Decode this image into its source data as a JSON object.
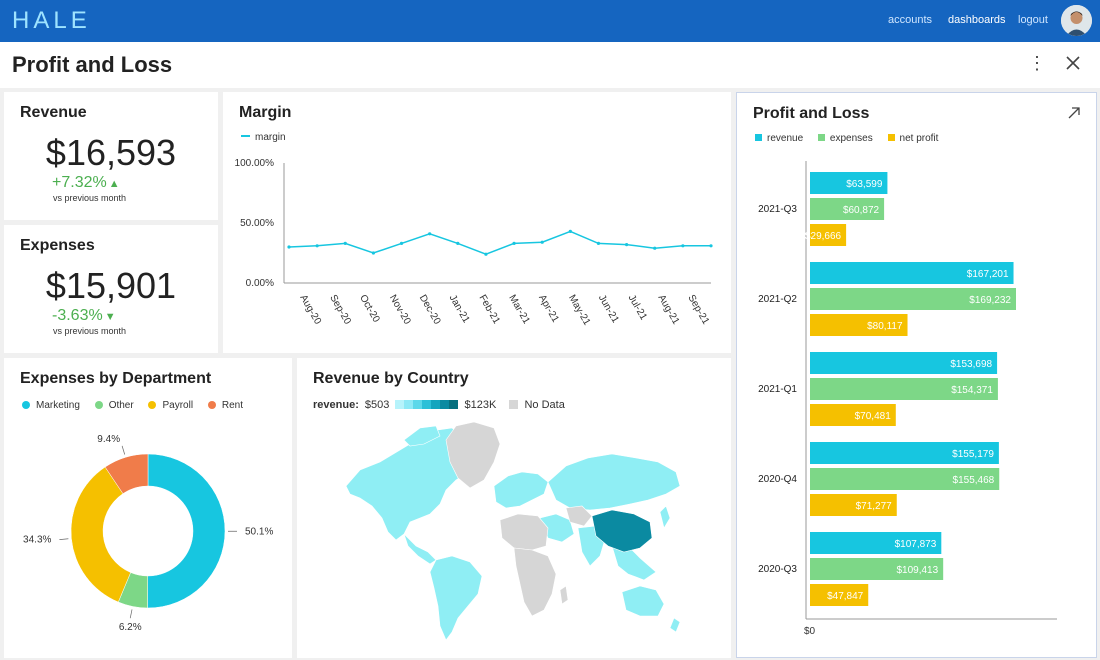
{
  "app": {
    "logo": "HALE",
    "nav": [
      {
        "label": "accounts"
      },
      {
        "label": "dashboards"
      },
      {
        "label": "logout"
      }
    ]
  },
  "page": {
    "title": "Profit and Loss"
  },
  "revenue_card": {
    "title": "Revenue",
    "value": "$16,593",
    "change": "+7.32%",
    "subtitle": "vs previous month"
  },
  "expenses_card": {
    "title": "Expenses",
    "value": "$15,901",
    "change": "-3.63%",
    "subtitle": "vs previous month"
  },
  "colors": {
    "up": "#4caf50",
    "down": "#4caf50",
    "revenue": "#17c6e0",
    "expenses": "#7dd787",
    "net_profit": "#f5c000",
    "rent": "#f07c4a",
    "no_data": "#d6d6d6"
  },
  "margin_card": {
    "title": "Margin",
    "legend": "margin"
  },
  "pl_card": {
    "title": "Profit and Loss",
    "legend": [
      "revenue",
      "expenses",
      "net profit"
    ],
    "axis_zero": "$0"
  },
  "dept_card": {
    "title": "Expenses by Department",
    "legend": [
      "Marketing",
      "Other",
      "Payroll",
      "Rent"
    ]
  },
  "country_card": {
    "title": "Revenue by Country",
    "scale_label": "revenue:",
    "scale_min": "$503",
    "scale_max": "$123K",
    "no_data": "No Data"
  },
  "chart_data": [
    {
      "type": "line",
      "title": "Margin",
      "series": [
        {
          "name": "margin",
          "values": [
            30,
            31,
            33,
            25,
            33,
            41,
            33,
            24,
            33,
            34,
            43,
            33,
            32,
            29,
            31,
            31
          ]
        }
      ],
      "x": [
        "Aug-20",
        "Sep-20",
        "Oct-20",
        "Nov-20",
        "Dec-20",
        "Jan-21",
        "Feb-21",
        "Mar-21",
        "Apr-21",
        "May-21",
        "Jun-21",
        "Jul-21",
        "Aug-21",
        "Sep-21"
      ],
      "y_ticks": [
        "100.00%",
        "50.00%",
        "0.00%"
      ],
      "ylim": [
        0,
        100
      ]
    },
    {
      "type": "bar",
      "title": "Profit and Loss",
      "orientation": "horizontal",
      "categories": [
        "2021-Q3",
        "2021-Q2",
        "2021-Q1",
        "2020-Q4",
        "2020-Q3"
      ],
      "series": [
        {
          "name": "revenue",
          "values": [
            63599,
            167201,
            153698,
            155179,
            107873
          ],
          "labels": [
            "$63,599",
            "$167,201",
            "$153,698",
            "$155,179",
            "$107,873"
          ]
        },
        {
          "name": "expenses",
          "values": [
            60872,
            169232,
            154371,
            155468,
            109413
          ],
          "labels": [
            "$60,872",
            "$169,232",
            "$154,371",
            "$155,468",
            "$109,413"
          ]
        },
        {
          "name": "net profit",
          "values": [
            29666,
            80117,
            70481,
            71277,
            47847
          ],
          "labels": [
            "$29,666",
            "$80,117",
            "$70,481",
            "$71,277",
            "$47,847"
          ]
        }
      ],
      "xlim": [
        0,
        175000
      ]
    },
    {
      "type": "pie",
      "title": "Expenses by Department",
      "categories": [
        "Marketing",
        "Other",
        "Payroll",
        "Rent"
      ],
      "values": [
        50.1,
        6.2,
        34.3,
        9.4
      ],
      "labels": [
        "50.1%",
        "6.2%",
        "34.3%",
        "9.4%"
      ]
    }
  ]
}
